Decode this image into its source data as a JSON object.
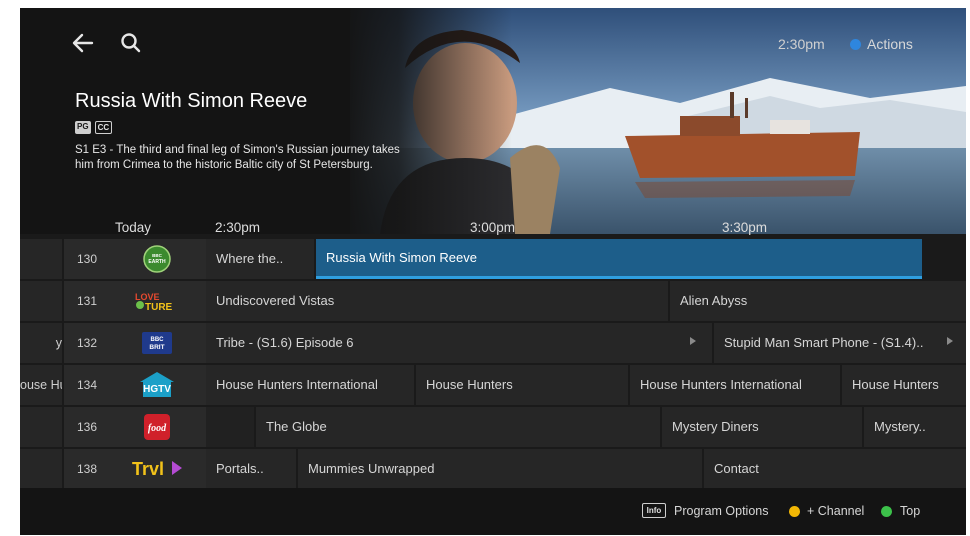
{
  "header": {
    "clock": "2:30pm",
    "actions_label": "Actions",
    "icons": [
      "back-arrow-icon",
      "search-icon"
    ]
  },
  "hero": {
    "title": "Russia With Simon Reeve",
    "ratings": [
      "PG",
      "CC"
    ],
    "description": "S1 E3 - The third and final leg of Simon's Russian journey takes him from Crimea to the historic Baltic city of St Petersburg."
  },
  "timebar": {
    "today": "Today",
    "slots": [
      "2:30pm",
      "3:00pm",
      "3:30pm"
    ]
  },
  "rows": [
    {
      "prev": "",
      "number": "130",
      "logo": "BBC EARTH",
      "programs": [
        "Where the..",
        "Russia With Simon Reeve"
      ]
    },
    {
      "prev": "",
      "number": "131",
      "logo": "LOVE NATURE",
      "programs": [
        "Undiscovered Vistas",
        "Alien Abyss"
      ]
    },
    {
      "prev": "y",
      "number": "132",
      "logo": "BBC BRIT",
      "programs": [
        "Tribe - (S1.6) Episode 6",
        "Stupid Man Smart Phone - (S1.4).."
      ]
    },
    {
      "prev": "ouse Hu",
      "number": "134",
      "logo": "HGTV",
      "programs": [
        "House Hunters International",
        "House Hunters",
        "House Hunters International",
        "House Hunters"
      ]
    },
    {
      "prev": "",
      "number": "136",
      "logo": "food",
      "programs": [
        "The Globe",
        "Mystery Diners",
        "Mystery.."
      ]
    },
    {
      "prev": "",
      "number": "138",
      "logo": "Trvl",
      "programs": [
        "Portals..",
        "Mummies Unwrapped",
        "Contact"
      ]
    }
  ],
  "footer": {
    "info_key": "Info",
    "program_options": "Program Options",
    "channel": "+ Channel",
    "top": "Top",
    "colors": {
      "yellow": "#f2b705",
      "green": "#3cc14a",
      "actions_blue": "#2e86de",
      "focus_blue": "#1d5e8a"
    }
  }
}
